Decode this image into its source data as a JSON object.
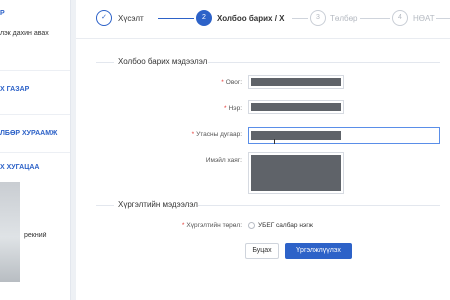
{
  "sidebar": {
    "items": [
      {
        "label": "Р"
      },
      {
        "label": "лэк дахин авах"
      },
      {
        "label": "Х ГАЗАР"
      },
      {
        "label": "ЛБӨР ХУРААМЖ"
      },
      {
        "label": "Х ХУГАЦАА"
      },
      {
        "label": "рекний"
      }
    ]
  },
  "stepper": {
    "steps": [
      {
        "number": "✓",
        "label": "Хүсэлт",
        "state": "done"
      },
      {
        "number": "2",
        "label": "Холбоо барих / Х",
        "state": "active"
      },
      {
        "number": "3",
        "label": "Төлбөр",
        "state": "idle"
      },
      {
        "number": "4",
        "label": "НӨАТ",
        "state": "idle"
      }
    ]
  },
  "contact_section": {
    "title": "Холбоо барих мэдээлэл",
    "fields": {
      "last_name": {
        "label": "Овог:",
        "required": true
      },
      "first_name": {
        "label": "Нэр:",
        "required": true
      },
      "phone": {
        "label": "Утасны дугаар:",
        "required": true
      },
      "email": {
        "label": "Имэйл хаяг:",
        "required": false
      }
    }
  },
  "delivery_section": {
    "title": "Хүргэлтийн мэдээлэл",
    "type_label": "Хүргэлтийн төрөл:",
    "option_label": "УБЕГ салбар нэгж"
  },
  "actions": {
    "back_label": "Буцах",
    "next_label": "Үргэлжлүүлэх"
  },
  "colors": {
    "accent": "#2d62c8",
    "required": "#e53935"
  }
}
